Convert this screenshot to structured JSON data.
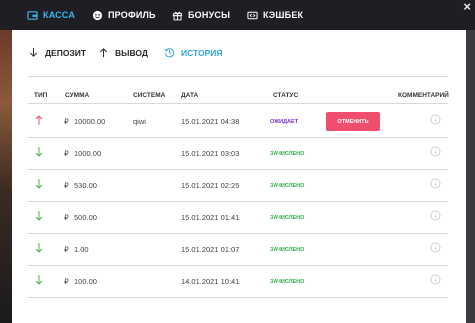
{
  "topnav": {
    "tabs": [
      {
        "label": "КАССА",
        "icon": "wallet-icon",
        "active": true
      },
      {
        "label": "ПРОФИЛЬ",
        "icon": "profile-icon",
        "active": false
      },
      {
        "label": "БОНУСЫ",
        "icon": "gift-icon",
        "active": false
      },
      {
        "label": "КЭШБЕК",
        "icon": "cashback-icon",
        "active": false
      }
    ],
    "close_label": "×"
  },
  "subtabs": [
    {
      "label": "ДЕПОЗИТ",
      "icon": "arrow-down-icon",
      "active": false
    },
    {
      "label": "ВЫВОД",
      "icon": "arrow-up-icon",
      "active": false
    },
    {
      "label": "ИСТОРИЯ",
      "icon": "history-icon",
      "active": true
    }
  ],
  "table": {
    "headers": {
      "type": "ТИП",
      "amount": "СУММА",
      "system": "СИСТЕМА",
      "date": "ДАТА",
      "status": "СТАТУС",
      "comment": "КОММЕНТАРИЙ"
    },
    "currency_symbol": "₽",
    "rows": [
      {
        "direction": "up",
        "amount": "10000.00",
        "system": "qiwi",
        "date": "15.01.2021 04:38",
        "status": "ОЖИДАЕТ",
        "status_color": "#7b2fd6",
        "action": "ОТМЕНИТЬ"
      },
      {
        "direction": "down",
        "amount": "1000.00",
        "system": "",
        "date": "15.01.2021 03:03",
        "status": "ЗАЧИСЛЕНО",
        "status_color": "#2bb34a",
        "action": ""
      },
      {
        "direction": "down",
        "amount": "530.00",
        "system": "",
        "date": "15.01.2021 02:25",
        "status": "ЗАЧИСЛЕНО",
        "status_color": "#2bb34a",
        "action": ""
      },
      {
        "direction": "down",
        "amount": "500.00",
        "system": "",
        "date": "15.01.2021 01:41",
        "status": "ЗАЧИСЛЕНО",
        "status_color": "#2bb34a",
        "action": ""
      },
      {
        "direction": "down",
        "amount": "1.00",
        "system": "",
        "date": "15.01.2021 01:07",
        "status": "ЗАЧИСЛЕНО",
        "status_color": "#2bb34a",
        "action": ""
      },
      {
        "direction": "down",
        "amount": "100.00",
        "system": "",
        "date": "14.01.2021 10:41",
        "status": "ЗАЧИСЛЕНО",
        "status_color": "#2bb34a",
        "action": ""
      }
    ]
  },
  "colors": {
    "accent": "#33a6dd",
    "deposit_arrow": "#4caf50",
    "withdraw_arrow": "#e94f6a",
    "cancel_button": "#ef4e6e"
  }
}
